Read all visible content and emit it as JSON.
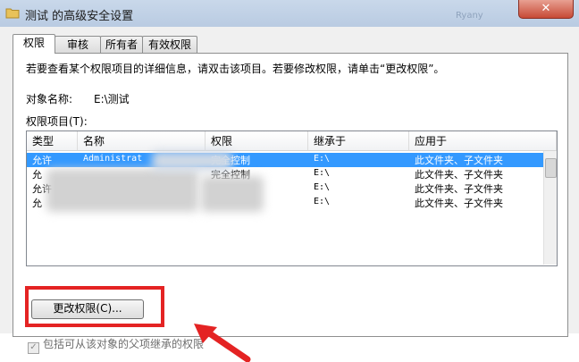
{
  "window": {
    "title": "测试 的高级安全设置",
    "title_ghost": "Ryany",
    "close_label": "✕"
  },
  "tabs": [
    {
      "label": "权限",
      "active": true
    },
    {
      "label": "审核"
    },
    {
      "label": "所有者"
    },
    {
      "label": "有效权限"
    }
  ],
  "panel": {
    "description": "若要查看某个权限项目的详细信息，请双击该项目。若要修改权限，请单击“更改权限”。",
    "object_name_label": "对象名称:",
    "object_name_value": "E:\\测试",
    "entries_label": "权限项目(T):"
  },
  "table": {
    "headers": [
      "类型",
      "名称",
      "权限",
      "继承于",
      "应用于"
    ],
    "rows": [
      {
        "type": "允许",
        "name": "Administrat",
        "permission": "完全控制",
        "inherited_from": "E:\\",
        "applies_to": "此文件夹、子文件夹",
        "selected": true
      },
      {
        "type": "允",
        "name": "",
        "permission": "完全控制",
        "inherited_from": "E:\\",
        "applies_to": "此文件夹、子文件夹"
      },
      {
        "type": "允许",
        "name": "",
        "permission": "",
        "inherited_from": "E:\\",
        "applies_to": "此文件夹、子文件夹"
      },
      {
        "type": "允",
        "name": "",
        "permission": "",
        "inherited_from": "E:\\",
        "applies_to": "此文件夹、子文件夹"
      }
    ]
  },
  "buttons": {
    "change_permissions": "更改权限(C)..."
  },
  "inherit_checkbox": {
    "label": "包括可从该对象的父项继承的权限",
    "checked": true
  },
  "colors": {
    "annotation_red": "#e42323",
    "selection_blue": "#3399ff"
  }
}
